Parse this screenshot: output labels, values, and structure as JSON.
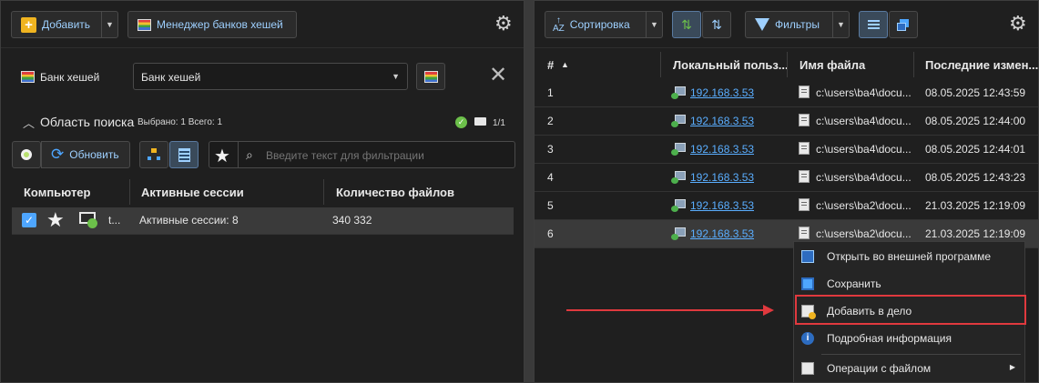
{
  "left": {
    "toolbar": {
      "add_label": "Добавить",
      "hash_manager_label": "Менеджер банков хешей"
    },
    "hashbank": {
      "label": "Банк хешей",
      "selected": "Банк хешей"
    },
    "search_area": {
      "title": "Область поиска",
      "summary": "Выбрано: 1 Всего: 1",
      "count": "1/1"
    },
    "refresh_label": "Обновить",
    "filter_placeholder": "Введите текст для фильтрации",
    "table": {
      "headers": [
        "Компьютер",
        "Активные сессии",
        "Количество файлов"
      ],
      "rows": [
        {
          "computer": "t...",
          "sessions": "Активные сессии: 8",
          "files": "340 332"
        }
      ]
    }
  },
  "right": {
    "toolbar": {
      "sort_label": "Сортировка",
      "filters_label": "Фильтры"
    },
    "table": {
      "headers": [
        "#",
        "Локальный польз...",
        "Имя файла",
        "Последние измен..."
      ],
      "rows": [
        {
          "n": "1",
          "ip": "192.168.3.53",
          "file": "c:\\users\\ba4\\docu...",
          "date": "08.05.2025 12:43:59"
        },
        {
          "n": "2",
          "ip": "192.168.3.53",
          "file": "c:\\users\\ba4\\docu...",
          "date": "08.05.2025 12:44:00"
        },
        {
          "n": "3",
          "ip": "192.168.3.53",
          "file": "c:\\users\\ba4\\docu...",
          "date": "08.05.2025 12:44:01"
        },
        {
          "n": "4",
          "ip": "192.168.3.53",
          "file": "c:\\users\\ba4\\docu...",
          "date": "08.05.2025 12:43:23"
        },
        {
          "n": "5",
          "ip": "192.168.3.53",
          "file": "c:\\users\\ba2\\docu...",
          "date": "21.03.2025 12:19:09"
        },
        {
          "n": "6",
          "ip": "192.168.3.53",
          "file": "c:\\users\\ba2\\docu...",
          "date": "21.03.2025 12:19:09"
        }
      ]
    }
  },
  "context_menu": {
    "items": [
      "Открыть во внешней программе",
      "Сохранить",
      "Добавить в дело",
      "Подробная информация",
      "Операции с файлом"
    ]
  },
  "colors": {
    "accent": "#5aaeff",
    "highlight": "#e0393e",
    "bg": "#1f1f1f"
  }
}
